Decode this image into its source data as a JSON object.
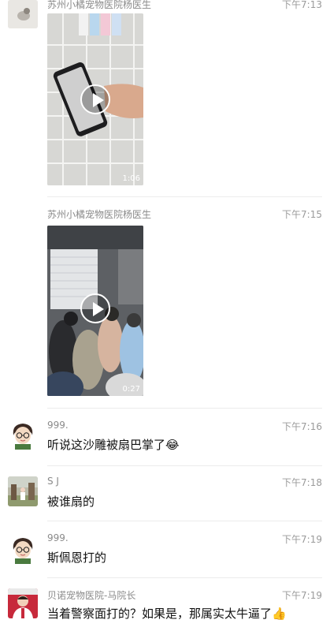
{
  "messages": [
    {
      "sender": "苏州小橘宠物医院杨医生",
      "time": "下午7:13",
      "type": "video",
      "duration": "1:06"
    },
    {
      "sender": "苏州小橘宠物医院杨医生",
      "time": "下午7:15",
      "type": "video",
      "duration": "0:27"
    },
    {
      "sender": "999.",
      "time": "下午7:16",
      "text": "听说这沙雕被扇巴掌了",
      "emoji": "😂"
    },
    {
      "sender": "S J",
      "time": "下午7:18",
      "text": "被谁扇的"
    },
    {
      "sender": "999.",
      "time": "下午7:19",
      "text": "斯佩恩打的"
    },
    {
      "sender": "贝诺宠物医院-马院长",
      "time": "下午7:19",
      "text": "当着警察面打的？如果是，那属实太牛逼了",
      "emoji": "👍"
    }
  ]
}
